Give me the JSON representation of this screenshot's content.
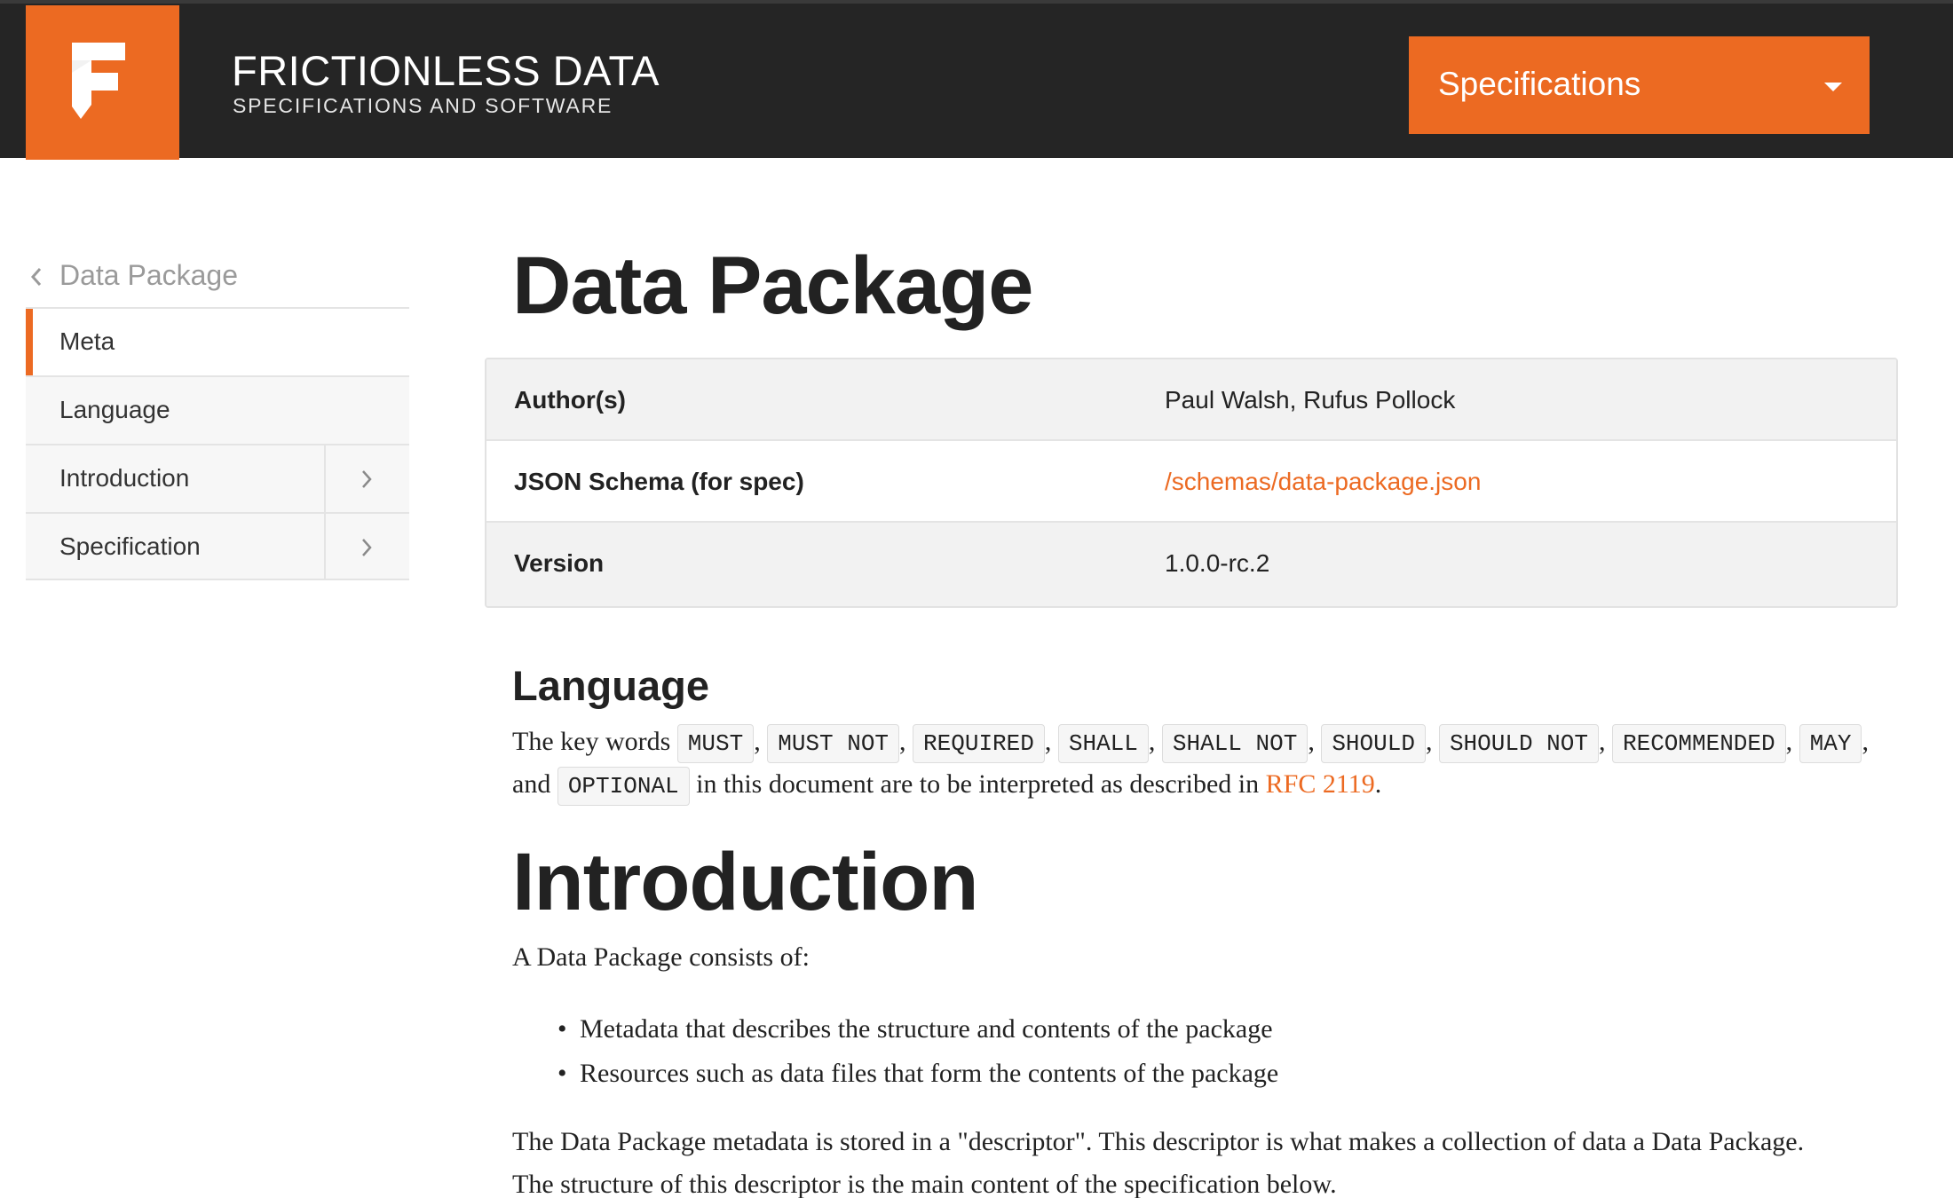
{
  "header": {
    "brand_title": "FRICTIONLESS DATA",
    "brand_subtitle": "SPECIFICATIONS AND SOFTWARE",
    "dropdown_label": "Specifications",
    "accent_color": "#ec6a22",
    "bg_color": "#252525"
  },
  "sidebar": {
    "back_label": "Data Package",
    "items": [
      {
        "label": "Meta",
        "active": true,
        "expandable": false
      },
      {
        "label": "Language",
        "active": false,
        "expandable": false
      },
      {
        "label": "Introduction",
        "active": false,
        "expandable": true
      },
      {
        "label": "Specification",
        "active": false,
        "expandable": true
      }
    ]
  },
  "main": {
    "title": "Data Package",
    "meta": [
      {
        "key": "Author(s)",
        "value": "Paul Walsh, Rufus Pollock"
      },
      {
        "key": "JSON Schema (for spec)",
        "value": "/schemas/data-package.json"
      },
      {
        "key": "Version",
        "value": "1.0.0-rc.2"
      }
    ],
    "language": {
      "heading": "Language",
      "prefix": "The key words",
      "keywords": [
        "MUST",
        "MUST NOT",
        "REQUIRED",
        "SHALL",
        "SHALL NOT",
        "SHOULD",
        "SHOULD NOT",
        "RECOMMENDED",
        "MAY",
        "OPTIONAL"
      ],
      "and_text": "and",
      "middle_text": "in this document are to be interpreted as described in",
      "rfc_link": "RFC 2119",
      "end_text": "."
    },
    "introduction": {
      "heading": "Introduction",
      "lead": "A Data Package consists of:",
      "bullets": [
        "Metadata that describes the structure and contents of the package",
        "Resources such as data files that form the contents of the package"
      ],
      "description_line1": "The Data Package metadata is stored in a \"descriptor\". This descriptor is what makes a collection of data a Data Package.",
      "description_line2": "The structure of this descriptor is the main content of the specification below."
    }
  }
}
